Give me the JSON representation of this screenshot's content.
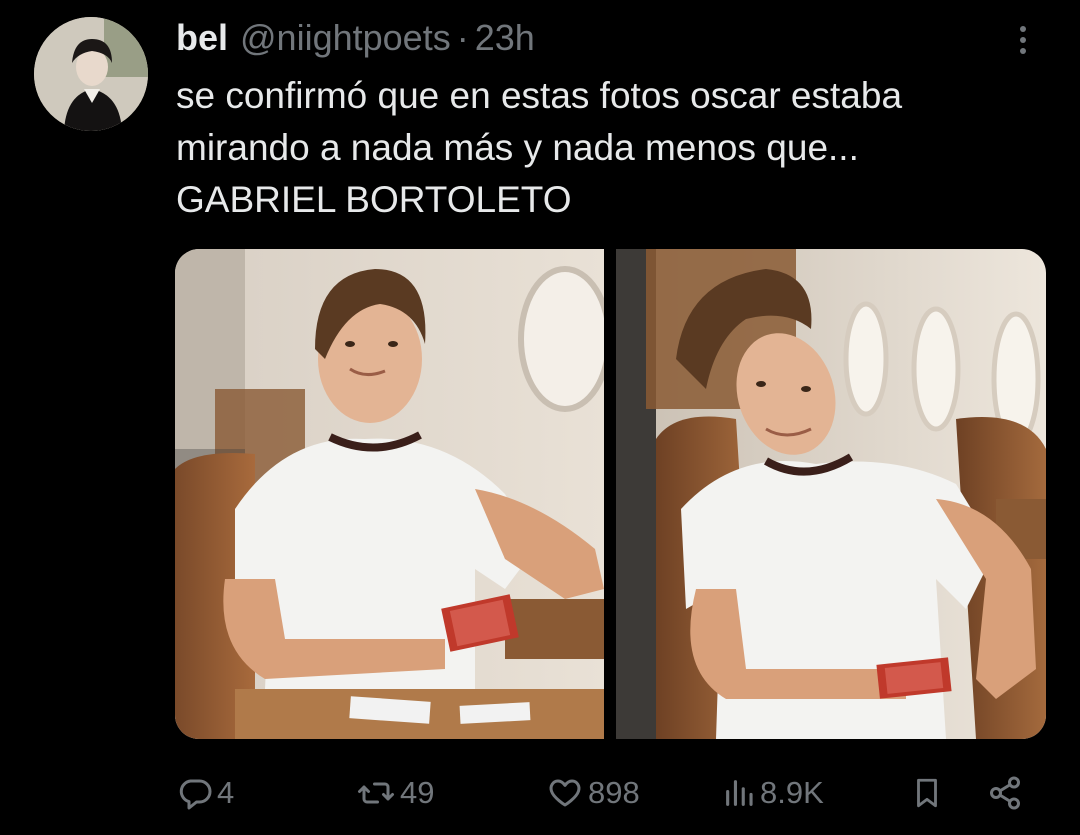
{
  "tweet": {
    "author": {
      "display_name": "bel",
      "handle": "@niightpoets",
      "separator": "·",
      "time": "23h"
    },
    "text_lines": [
      "se confirmó que en estas fotos oscar estaba",
      "mirando a nada más y nada menos que...",
      "GABRIEL BORTOLETO"
    ],
    "media": {
      "photos": [
        {
          "subject": "young man in white t-shirt holding playing cards inside private jet, looking at camera"
        },
        {
          "subject": "same young man leaning forward with cards, head tilted, private jet cabin"
        }
      ]
    },
    "actions": {
      "replies": "4",
      "reposts": "49",
      "likes": "898",
      "views": "8.9K"
    }
  },
  "icons": {
    "more": "more-vertical-icon",
    "reply": "reply-bubble-icon",
    "repost": "repost-arrows-icon",
    "like": "heart-icon",
    "views": "views-bar-chart-icon",
    "bookmark": "bookmark-icon",
    "share": "share-nodes-icon"
  },
  "colors": {
    "background": "#000000",
    "text_primary": "#e7e9ea",
    "text_secondary": "#71767b"
  }
}
